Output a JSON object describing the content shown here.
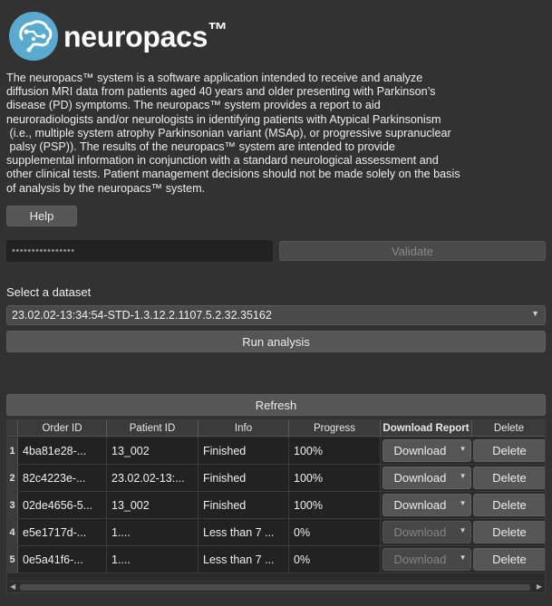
{
  "app": {
    "brand": "neuropacs",
    "trademark": "™",
    "logo_icon": "brain-circuit-icon",
    "accent_color": "#5aa9cf"
  },
  "description": "The neuropacs™ system is a software application intended to receive and analyze\ndiffusion MRI data from patients aged 40 years and older presenting with Parkinson’s\ndisease (PD) symptoms. The neuropacs™ system provides a report to aid\nneuroradiologists and/or neurologists in identifying patients with Atypical Parkinsonism\n (i.e., multiple system atrophy Parkinsonian variant (MSAp), or progressive supranuclear\n palsy (PSP)). The results of the neuropacs™ system are intended to provide\nsupplemental information in conjunction with a standard neurological assessment and\nother clinical tests. Patient management decisions should not be made solely on the basis\nof analysis by the neuropacs™ system.",
  "buttons": {
    "help": "Help",
    "validate": "Validate",
    "run_analysis": "Run analysis",
    "refresh": "Refresh"
  },
  "api_key": {
    "masked_value": "••••••••••••••••"
  },
  "dataset": {
    "label": "Select a dataset",
    "selected": "23.02.02-13:34:54-STD-1.3.12.2.1107.5.2.32.35162"
  },
  "table": {
    "columns": [
      "Order ID",
      "Patient ID",
      "Info",
      "Progress",
      "Download Report",
      "Delete"
    ],
    "rows": [
      {
        "num": "1",
        "order_id": "4ba81e28-...",
        "patient_id": "13_002",
        "info": "Finished",
        "progress": "100%",
        "download": "Download",
        "delete": "Delete",
        "download_enabled": true
      },
      {
        "num": "2",
        "order_id": "82c4223e-...",
        "patient_id": "23.02.02-13:...",
        "info": "Finished",
        "progress": "100%",
        "download": "Download",
        "delete": "Delete",
        "download_enabled": true
      },
      {
        "num": "3",
        "order_id": "02de4656-5...",
        "patient_id": "13_002",
        "info": "Finished",
        "progress": "100%",
        "download": "Download",
        "delete": "Delete",
        "download_enabled": true
      },
      {
        "num": "4",
        "order_id": "e5e1717d-...",
        "patient_id": "1....",
        "info": "Less than 7 ...",
        "progress": "0%",
        "download": "Download",
        "delete": "Delete",
        "download_enabled": false
      },
      {
        "num": "5",
        "order_id": "0e5a41f6-...",
        "patient_id": "1....",
        "info": "Less than 7 ...",
        "progress": "0%",
        "download": "Download",
        "delete": "Delete",
        "download_enabled": false
      }
    ]
  }
}
